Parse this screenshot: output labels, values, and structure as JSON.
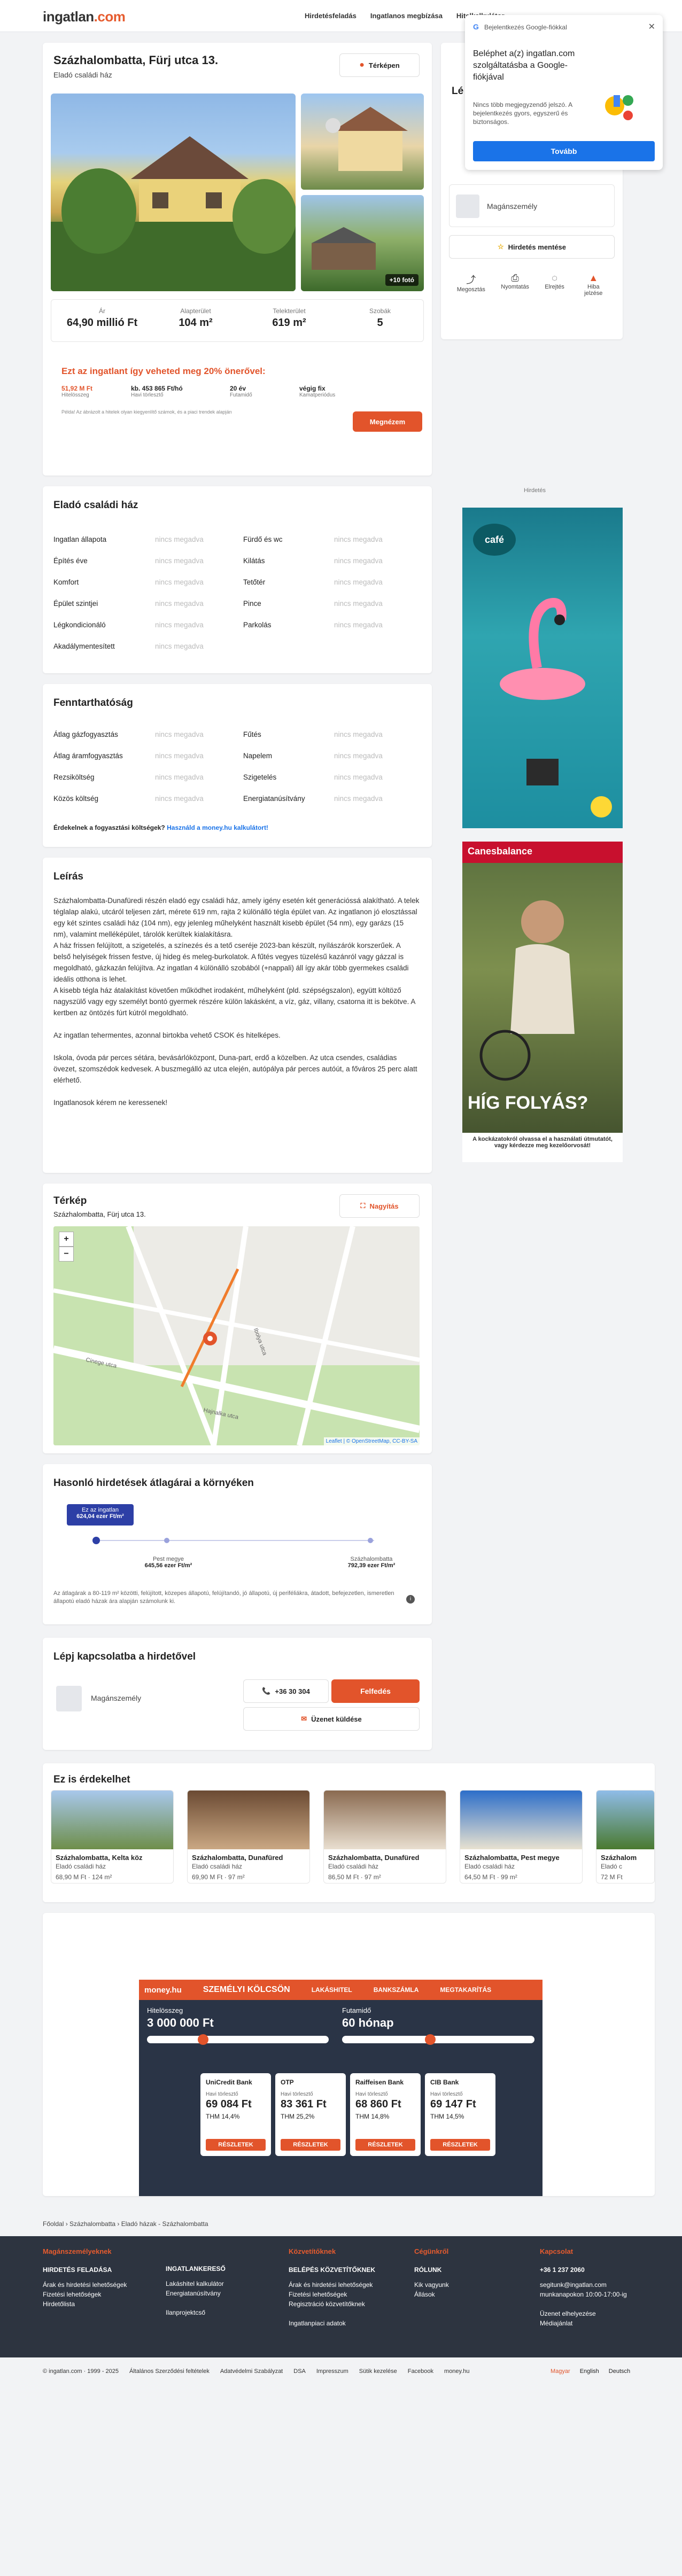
{
  "header": {
    "logo": "ingatlan",
    "logo_tld": ".com",
    "nav": [
      "Hirdetésfeladás",
      "Ingatlanos megbízása",
      "Hitelkalkulátor"
    ]
  },
  "listing": {
    "title": "Százhalombatta, Fürj utca 13.",
    "subtitle": "Eladó családi ház",
    "map_button": "Térképen",
    "photo_count": "+10 fotó",
    "stats": [
      {
        "label": "Ár",
        "value": "64,90 millió Ft"
      },
      {
        "label": "Alapterület",
        "value": "104 m²"
      },
      {
        "label": "Telekterület",
        "value": "619 m²"
      },
      {
        "label": "Szobák",
        "value": "5"
      }
    ],
    "loan_promo": {
      "headline": "Ezt az ingatlant így veheted meg 20% önerővel:",
      "cols": [
        {
          "v": "51,92 M Ft",
          "l": "Hitelösszeg"
        },
        {
          "v": "kb. 453 865 Ft/hó",
          "l": "Havi törlesztő"
        },
        {
          "v": "20 év",
          "l": "Futamidő"
        },
        {
          "v": "végig fix",
          "l": "Kamatperiódus"
        }
      ],
      "note": "Példa! Az ábrázolt a hitelek olyan kiegyenlítő számok, és a piaci trendek alapján",
      "cta": "Megnézem"
    }
  },
  "sidebar": {
    "title": "Lé",
    "user": "Magánszemély",
    "save_button": "Hirdetés mentése",
    "actions": [
      "Megosztás",
      "Nyomtatás",
      "Elrejtés",
      "Hiba jelzése"
    ]
  },
  "google_popup": {
    "header": "Bejelentkezés Google-fiókkal",
    "title": "Beléphet a(z) ingatlan.com szolgáltatásba a Google-fiókjával",
    "body": "Nincs több megjegyzendő jelszó. A bejelentkezés gyors, egyszerű és biztonságos.",
    "button": "Tovább"
  },
  "ads": {
    "label": "Hirdetés",
    "ad1_brand": "café",
    "ad2_brand": "Canesbalance",
    "ad2_headline": "HÍG FOLYÁS?",
    "ad2_caption": "A kockázatokról olvassa el a használati útmutatót, vagy kérdezze meg kezelőorvosát!"
  },
  "props": {
    "title": "Eladó családi ház",
    "na": "nincs megadva",
    "left": [
      "Ingatlan állapota",
      "Építés éve",
      "Komfort",
      "Épület szintjei",
      "Légkondicionáló",
      "Akadálymentesített"
    ],
    "right": [
      "Fürdő és wc",
      "Kilátás",
      "Tetőtér",
      "Pince",
      "Parkolás"
    ]
  },
  "sustain": {
    "title": "Fenntarthatóság",
    "left": [
      "Átlag gázfogyasztás",
      "Átlag áramfogyasztás",
      "Rezsiköltség",
      "Közös költség"
    ],
    "right": [
      "Fűtés",
      "Napelem",
      "Szigetelés",
      "Energiatanúsítvány"
    ],
    "note": "Érdekelnek a fogyasztási költségek?",
    "link": "Használd a money.hu kalkulátort!"
  },
  "description": {
    "title": "Leírás",
    "paras": [
      "Százhalombatta-Dunafüredi részén eladó egy családi ház, amely igény esetén két generációssá alakítható. A telek téglalap alakú, utcáról teljesen zárt, mérete 619 nm, rajta 2 különálló tégla épület van. Az ingatlanon jó elosztással egy két szintes családi ház (104 nm), egy jelenleg műhelyként használt kisebb épület (54 nm), egy garázs (15 nm), valamint melléképület, tárolók kerültek kialakításra.",
      "A ház frissen felújított, a szigetelés, a színezés és a tető cseréje 2023-ban készült, nyílászárók korszerűek. A belső helyiségek frissen festve, új hideg és meleg-burkolatok. A fűtés vegyes tüzelésű kazánról vagy gázzal is megoldható, gázkazán felújítva. Az ingatlan 4 különálló szobából (+nappali) áll így akár több gyermekes családi ideális otthona is lehet.",
      "A kisebb tégla ház átalakítást követően működhet irodaként, műhelyként (pld. szépségszalon), együtt költöző nagyszülő vagy egy személyt bontó gyermek részére külön lakásként, a víz, gáz, villany, csatorna itt is bekötve. A kertben az öntözés fúrt kútról megoldható.",
      "Az ingatlan tehermentes, azonnal birtokba vehető CSOK és hitelképes.",
      "Iskola, óvoda pár perces sétára, bevásárlóközpont, Duna-part, erdő a közelben. Az utca csendes, családias övezet, szomszédok kedvesek. A buszmegálló az utca elején, autópálya pár perces autóút, a főváros 25 perc alatt elérhető.",
      "Ingatlanosok kérem ne keressenek!"
    ]
  },
  "map": {
    "title": "Térkép",
    "address": "Százhalombatta, Fürj utca 13.",
    "enlarge": "Nagyítás",
    "streets": [
      "Cinege utca",
      "Ibolya utca",
      "Hajnalka utca"
    ],
    "attribution": "Leaflet | © OpenStreetMap, CC-BY-SA"
  },
  "similar_avg": {
    "title": "Hasonló hirdetések átlagárai a környéken",
    "bubble": "Ez az ingatlan",
    "bubble_val": "624,04 ezer Ft/m²",
    "mid_label": "Pest megye",
    "mid_val": "645,56 ezer Ft/m²",
    "right_label": "Százhalombatta",
    "right_val": "792,39 ezer Ft/m²",
    "note": "Az átlagárak a 80-119 m² közötti, felújított, közepes állapotú, felújítandó, jó állapotú, új periféliákra, átadott, befejezetlen, ismeretlen állapotú eladó házak ára alapján számolunk ki."
  },
  "contact": {
    "title": "Lépj kapcsolatba a hirdetővel",
    "user": "Magánszemély",
    "phone": "+36 30 304",
    "reveal": "Felfedés",
    "message": "Üzenet küldése"
  },
  "interest": {
    "title": "Ez is érdekelhet",
    "items": [
      {
        "t": "Százhalombatta, Kelta köz",
        "s": "Eladó családi ház",
        "p": "68,90 M Ft",
        "a": "124 m²"
      },
      {
        "t": "Százhalombatta, Dunafüred",
        "s": "Eladó családi ház",
        "p": "69,90 M Ft",
        "a": "97 m²"
      },
      {
        "t": "Százhalombatta, Dunafüred",
        "s": "Eladó családi ház",
        "p": "86,50 M Ft",
        "a": "97 m²"
      },
      {
        "t": "Százhalombatta, Pest megye",
        "s": "Eladó családi ház",
        "p": "64,50 M Ft",
        "a": "99 m²"
      },
      {
        "t": "Százhalom",
        "s": "Eladó c",
        "p": "72 M Ft",
        "a": ""
      }
    ]
  },
  "money": {
    "brand": "money.hu",
    "tabs": [
      "SZEMÉLYI KÖLCSÖN",
      "LAKÁSHITEL",
      "BANKSZÁMLA",
      "MEGTAKARÍTÁS"
    ],
    "amount_label": "Hitelösszeg",
    "amount": "3 000 000 Ft",
    "term_label": "Futamidő",
    "term": "60 hónap",
    "banks": [
      {
        "n": "UniCredit Bank",
        "v": "69 084 Ft",
        "t": "THM 14,4%"
      },
      {
        "n": "OTP",
        "v": "83 361 Ft",
        "t": "THM 25,2%"
      },
      {
        "n": "Raiffeisen Bank",
        "v": "68 860 Ft",
        "t": "THM 14,8%"
      },
      {
        "n": "CIB Bank",
        "v": "69 147 Ft",
        "t": "THM 14,5%"
      }
    ],
    "monthly": "Havi törlesztő",
    "details": "RÉSZLETEK"
  },
  "breadcrumb": "Főoldal  ›  Százhalombatta  ›  Eladó házak - Százhalombatta",
  "footer": {
    "cols": [
      {
        "t": "Magánszemélyeknek",
        "b": "HIRDETÉS FELADÁSA",
        "l": [
          "Árak és hirdetési lehetőségek",
          "Fizetési lehetőségek",
          "Hirdetőlista"
        ]
      },
      {
        "t": "",
        "b": "INGATLANKERESŐ",
        "l": [
          "Lakáshitel kalkulátor",
          "Energiatanúsítvány",
          "",
          "Ilanprojektcső"
        ]
      },
      {
        "t": "Közvetítőknek",
        "b": "BELÉPÉS KÖZVETÍTŐKNEK",
        "l": [
          "Árak és hirdetési lehetőségek",
          "Fizetési lehetőségek",
          "Regisztráció közvetítőknek",
          "",
          "Ingatlanpiaci adatok"
        ]
      },
      {
        "t": "Cégünkről",
        "b": "RÓLUNK",
        "l": [
          "Kik vagyunk",
          "Állások"
        ]
      },
      {
        "t": "Kapcsolat",
        "b": "+36 1 237 2060",
        "l": [
          "segitunk@ingatlan.com",
          "munkanapokon 10:00-17:00-ig",
          "",
          "Üzenet elhelyezése",
          "Médiajánlat"
        ]
      }
    ]
  },
  "bottom": {
    "copy": "© ingatlan.com · 1999 - 2025",
    "links": [
      "Általános Szerződési feltételek",
      "Adatvédelmi Szabályzat",
      "DSA",
      "Impresszum",
      "Sütik kezelése",
      "Facebook",
      "money.hu"
    ],
    "langs": [
      "Magyar",
      "English",
      "Deutsch"
    ]
  }
}
